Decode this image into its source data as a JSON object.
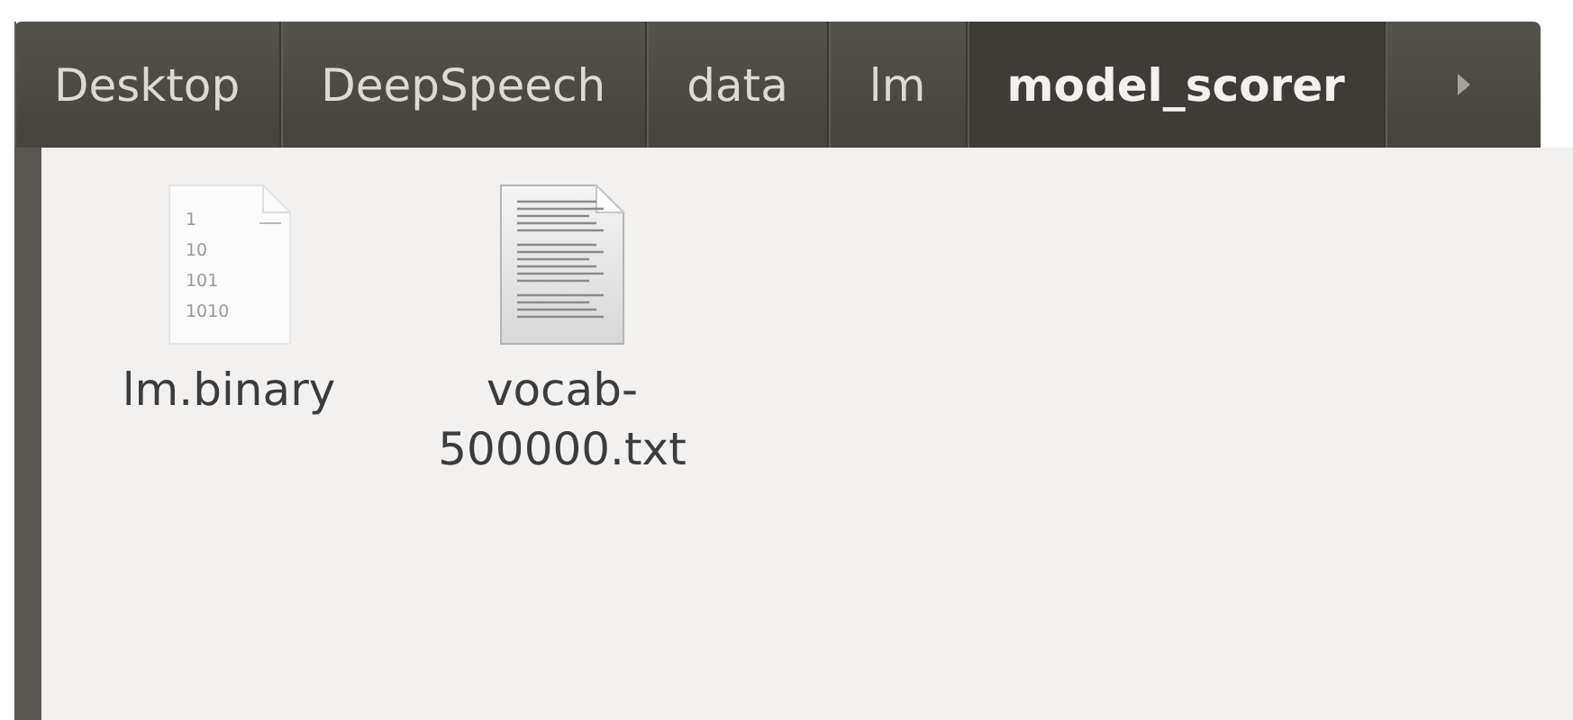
{
  "path_bar": {
    "segments": [
      {
        "label": "Desktop",
        "selected": false
      },
      {
        "label": "DeepSpeech",
        "selected": false
      },
      {
        "label": "data",
        "selected": false
      },
      {
        "label": "lm",
        "selected": false
      },
      {
        "label": "model_scorer",
        "selected": true
      }
    ]
  },
  "files": [
    {
      "name": "lm.binary",
      "kind": "binary",
      "icon_lines": [
        "1",
        "10",
        "101",
        "1010"
      ]
    },
    {
      "name": "vocab-500000.txt",
      "kind": "text"
    }
  ]
}
